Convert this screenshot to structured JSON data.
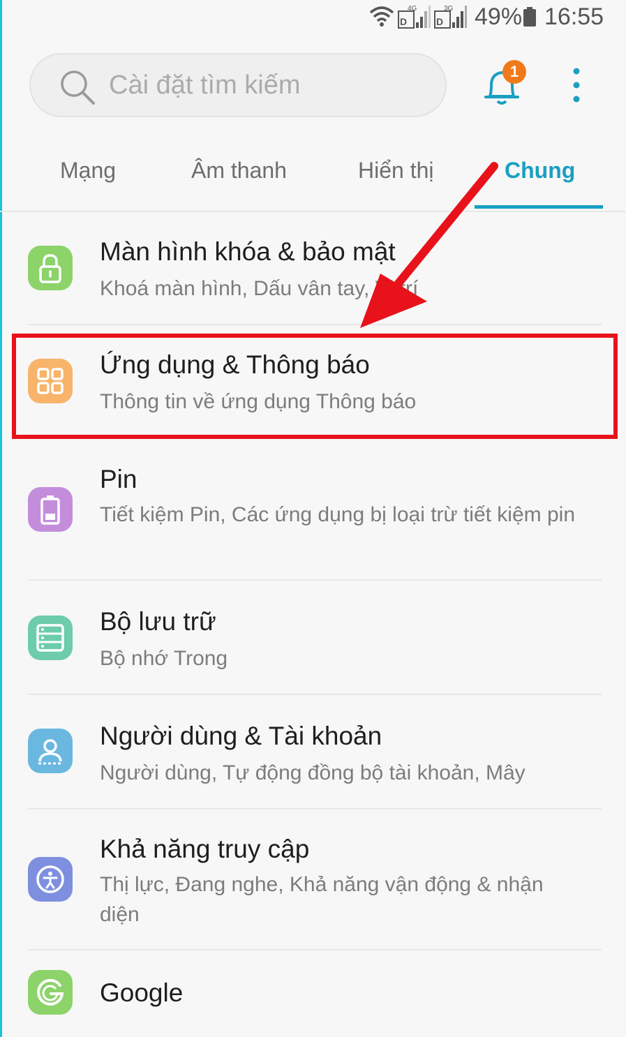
{
  "status_bar": {
    "battery": "49%",
    "time": "16:55",
    "net1": "4G",
    "net2": "3G"
  },
  "search": {
    "placeholder": "Cài đặt tìm kiếm"
  },
  "header": {
    "notification_count": "1"
  },
  "tabs": [
    {
      "label": "Mạng"
    },
    {
      "label": "Âm thanh"
    },
    {
      "label": "Hiển thị"
    },
    {
      "label": "Chung",
      "selected": true
    }
  ],
  "colors": {
    "accent": "#1a9fc2",
    "highlight": "#e8121b",
    "badge": "#f07a1a"
  },
  "items": [
    {
      "icon": "lock-icon",
      "color": "#8cd36a",
      "title": "Màn hình khóa & bảo mật",
      "subtitle": "Khoá màn hình, Dấu vân tay, Vị trí"
    },
    {
      "icon": "apps-grid-icon",
      "color": "#f7b46a",
      "title": "Ứng dụng & Thông báo",
      "subtitle": "Thông tin về ứng dụng Thông báo"
    },
    {
      "icon": "battery-icon",
      "color": "#c48ddc",
      "title": "Pin",
      "subtitle": "Tiết kiệm Pin, Các ứng dụng bị loại trừ tiết kiệm pin"
    },
    {
      "icon": "storage-icon",
      "color": "#6cccab",
      "title": "Bộ lưu trữ",
      "subtitle": "Bộ nhớ Trong"
    },
    {
      "icon": "user-account-icon",
      "color": "#6ab8e0",
      "title": "Người dùng & Tài khoản",
      "subtitle": "Người dùng, Tự động đồng bộ tài khoản, Mây"
    },
    {
      "icon": "accessibility-icon",
      "color": "#7e8fe0",
      "title": "Khả năng truy cập",
      "subtitle": "Thị lực, Đang nghe, Khả năng vận động & nhận diện"
    },
    {
      "icon": "google-icon",
      "color": "#8cd36a",
      "title": "Google",
      "subtitle": ""
    }
  ]
}
